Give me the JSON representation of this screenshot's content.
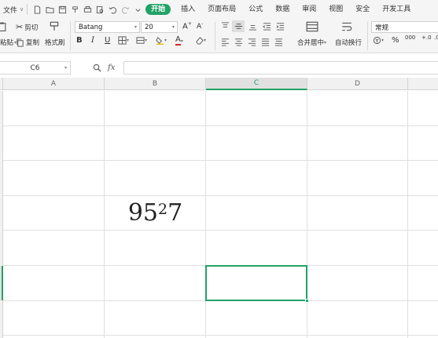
{
  "menubar": {
    "file_label": "文件",
    "quick_access_icons": [
      "new-file-icon",
      "open-folder-icon",
      "save-icon",
      "format-painter-icon",
      "print-icon",
      "print-preview-icon",
      "undo-icon",
      "redo-icon",
      "customize-icon"
    ],
    "tabs": [
      {
        "label": "开始",
        "active": true
      },
      {
        "label": "插入"
      },
      {
        "label": "页面布局"
      },
      {
        "label": "公式"
      },
      {
        "label": "数据"
      },
      {
        "label": "审阅"
      },
      {
        "label": "视图"
      },
      {
        "label": "安全"
      },
      {
        "label": "开发工具"
      }
    ]
  },
  "ribbon": {
    "paste_label": "粘贴",
    "cut_label": "剪切",
    "copy_label": "复制",
    "format_painter_label": "格式刷",
    "font_name": "Batang",
    "font_size": "20",
    "bold": "B",
    "italic": "I",
    "underline": "U",
    "merge_center_label": "合并居中",
    "wrap_text_label": "自动换行",
    "number_format": "常规",
    "percent": "%",
    "thousands": "000"
  },
  "formula_bar": {
    "name_box": "C6",
    "fx_label": "fx",
    "formula": ""
  },
  "sheet": {
    "columns": [
      "A",
      "B",
      "C",
      "D"
    ],
    "selected_column": "C",
    "cell_b5": {
      "base": "95",
      "sup": "2",
      "tail": "7"
    }
  },
  "colors": {
    "accent": "#21a366"
  }
}
